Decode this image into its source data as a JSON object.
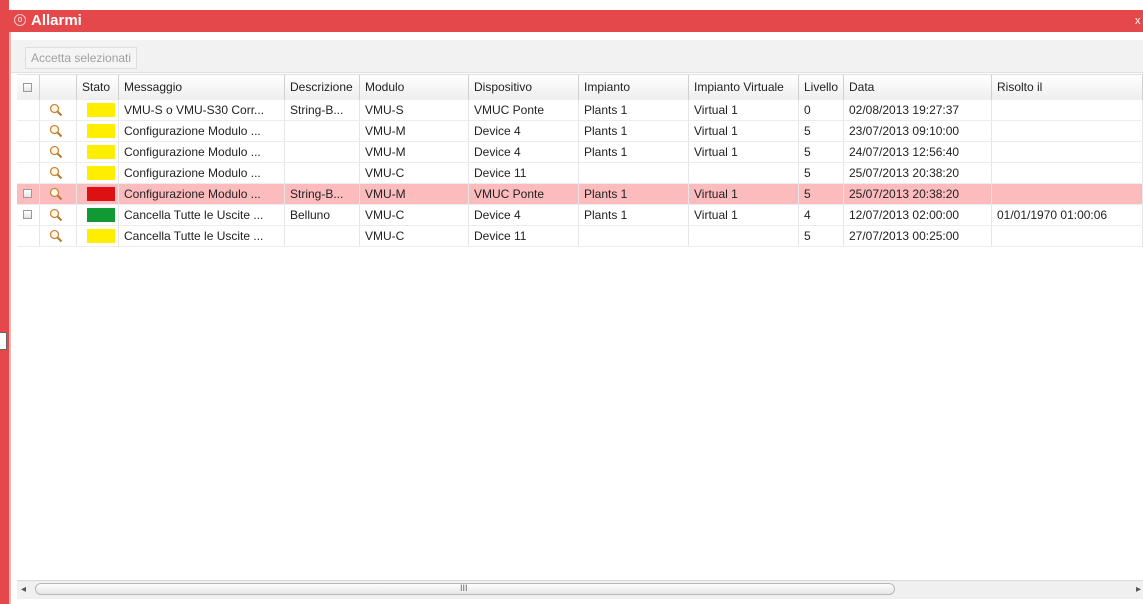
{
  "window": {
    "title": "Allarmi",
    "close_label": "x"
  },
  "toolbar": {
    "accept_label": "Accetta selezionati"
  },
  "colors": {
    "accent": "#e5484a",
    "selected_row": "#fcbcbd",
    "status_yellow": "#ffee00",
    "status_red": "#dd1111",
    "status_green": "#119933"
  },
  "columns": [
    "",
    "",
    "Stato",
    "Messaggio",
    "Descrizione",
    "Modulo",
    "Dispositivo",
    "Impianto",
    "Impianto Virtuale",
    "Livello",
    "Data",
    "Risolto il"
  ],
  "rows": [
    {
      "checkbox": false,
      "status": "yellow",
      "messaggio": "VMU-S o VMU-S30 Corr...",
      "descrizione": "String-B...",
      "modulo": "VMU-S",
      "dispositivo": "VMUC Ponte",
      "impianto": "Plants 1",
      "impianto_virtuale": "Virtual 1",
      "livello": "0",
      "data": "02/08/2013 19:27:37",
      "risolto": "",
      "selected": false
    },
    {
      "checkbox": false,
      "status": "yellow",
      "messaggio": "Configurazione Modulo ...",
      "descrizione": "",
      "modulo": "VMU-M",
      "dispositivo": "Device 4",
      "impianto": "Plants 1",
      "impianto_virtuale": "Virtual 1",
      "livello": "5",
      "data": "23/07/2013 09:10:00",
      "risolto": "",
      "selected": false
    },
    {
      "checkbox": false,
      "status": "yellow",
      "messaggio": "Configurazione Modulo ...",
      "descrizione": "",
      "modulo": "VMU-M",
      "dispositivo": "Device 4",
      "impianto": "Plants 1",
      "impianto_virtuale": "Virtual 1",
      "livello": "5",
      "data": "24/07/2013 12:56:40",
      "risolto": "",
      "selected": false
    },
    {
      "checkbox": false,
      "status": "yellow",
      "messaggio": "Configurazione Modulo ...",
      "descrizione": "",
      "modulo": "VMU-C",
      "dispositivo": "Device 11",
      "impianto": "",
      "impianto_virtuale": "",
      "livello": "5",
      "data": "25/07/2013 20:38:20",
      "risolto": "",
      "selected": false
    },
    {
      "checkbox": true,
      "status": "red",
      "messaggio": "Configurazione Modulo ...",
      "descrizione": "String-B...",
      "modulo": "VMU-M",
      "dispositivo": "VMUC Ponte",
      "impianto": "Plants 1",
      "impianto_virtuale": "Virtual 1",
      "livello": "5",
      "data": "25/07/2013 20:38:20",
      "risolto": "",
      "selected": true
    },
    {
      "checkbox": true,
      "status": "green",
      "messaggio": "Cancella Tutte le Uscite ...",
      "descrizione": "Belluno",
      "modulo": "VMU-C",
      "dispositivo": "Device 4",
      "impianto": "Plants 1",
      "impianto_virtuale": "Virtual 1",
      "livello": "4",
      "data": "12/07/2013 02:00:00",
      "risolto": "01/01/1970 01:00:06",
      "selected": false
    },
    {
      "checkbox": false,
      "status": "yellow",
      "messaggio": "Cancella Tutte le Uscite ...",
      "descrizione": "",
      "modulo": "VMU-C",
      "dispositivo": "Device 11",
      "impianto": "",
      "impianto_virtuale": "",
      "livello": "5",
      "data": "27/07/2013 00:25:00",
      "risolto": "",
      "selected": false
    }
  ],
  "scrollbar": {
    "grip": "III",
    "left_arrow": "◂",
    "right_arrow": "▸"
  }
}
